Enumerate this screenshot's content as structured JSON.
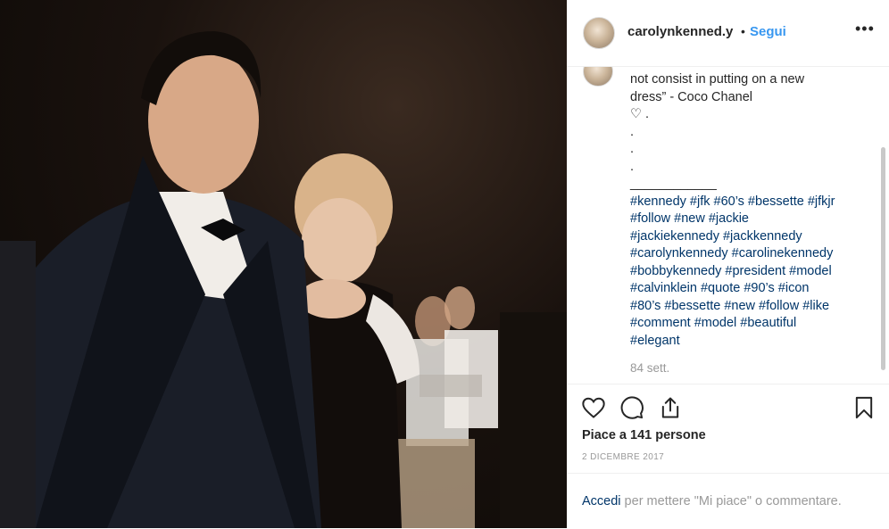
{
  "photo": {
    "alt_subject": "photo"
  },
  "header": {
    "username": "carolynkenned.y",
    "separator": "•",
    "follow_label": "Segui",
    "more_label": "•••"
  },
  "caption": {
    "lines": [
      "not consist in putting on a new",
      "dress” - Coco Chanel",
      "♡ .",
      ".",
      ".",
      ".",
      "____________"
    ],
    "hashtag_lines": [
      "#kennedy #jfk #60’s #bessette #jfkjr",
      "#follow #new #jackie",
      "#jackiekennedy #jackkennedy",
      "#carolynkennedy #carolinekennedy",
      "#bobbykennedy #president #model",
      "#calvinklein #quote #90’s #icon",
      "#80’s #bessette #new #follow #like",
      "#comment #model #beautiful",
      "#elegant"
    ],
    "time_ago": "84 sett."
  },
  "actions": {
    "like_icon": "heart-icon",
    "comment_icon": "comment-icon",
    "share_icon": "share-icon",
    "save_icon": "bookmark-icon",
    "likes_text": "Piace a 141 persone",
    "date_text": "2 DICEMBRE 2017"
  },
  "footer": {
    "login_link": "Accedi",
    "login_rest": " per mettere \"Mi piace\" o commentare."
  },
  "colors": {
    "link_blue": "#3897f0",
    "hashtag_blue": "#003569",
    "muted_gray": "#999999",
    "text": "#262626"
  }
}
